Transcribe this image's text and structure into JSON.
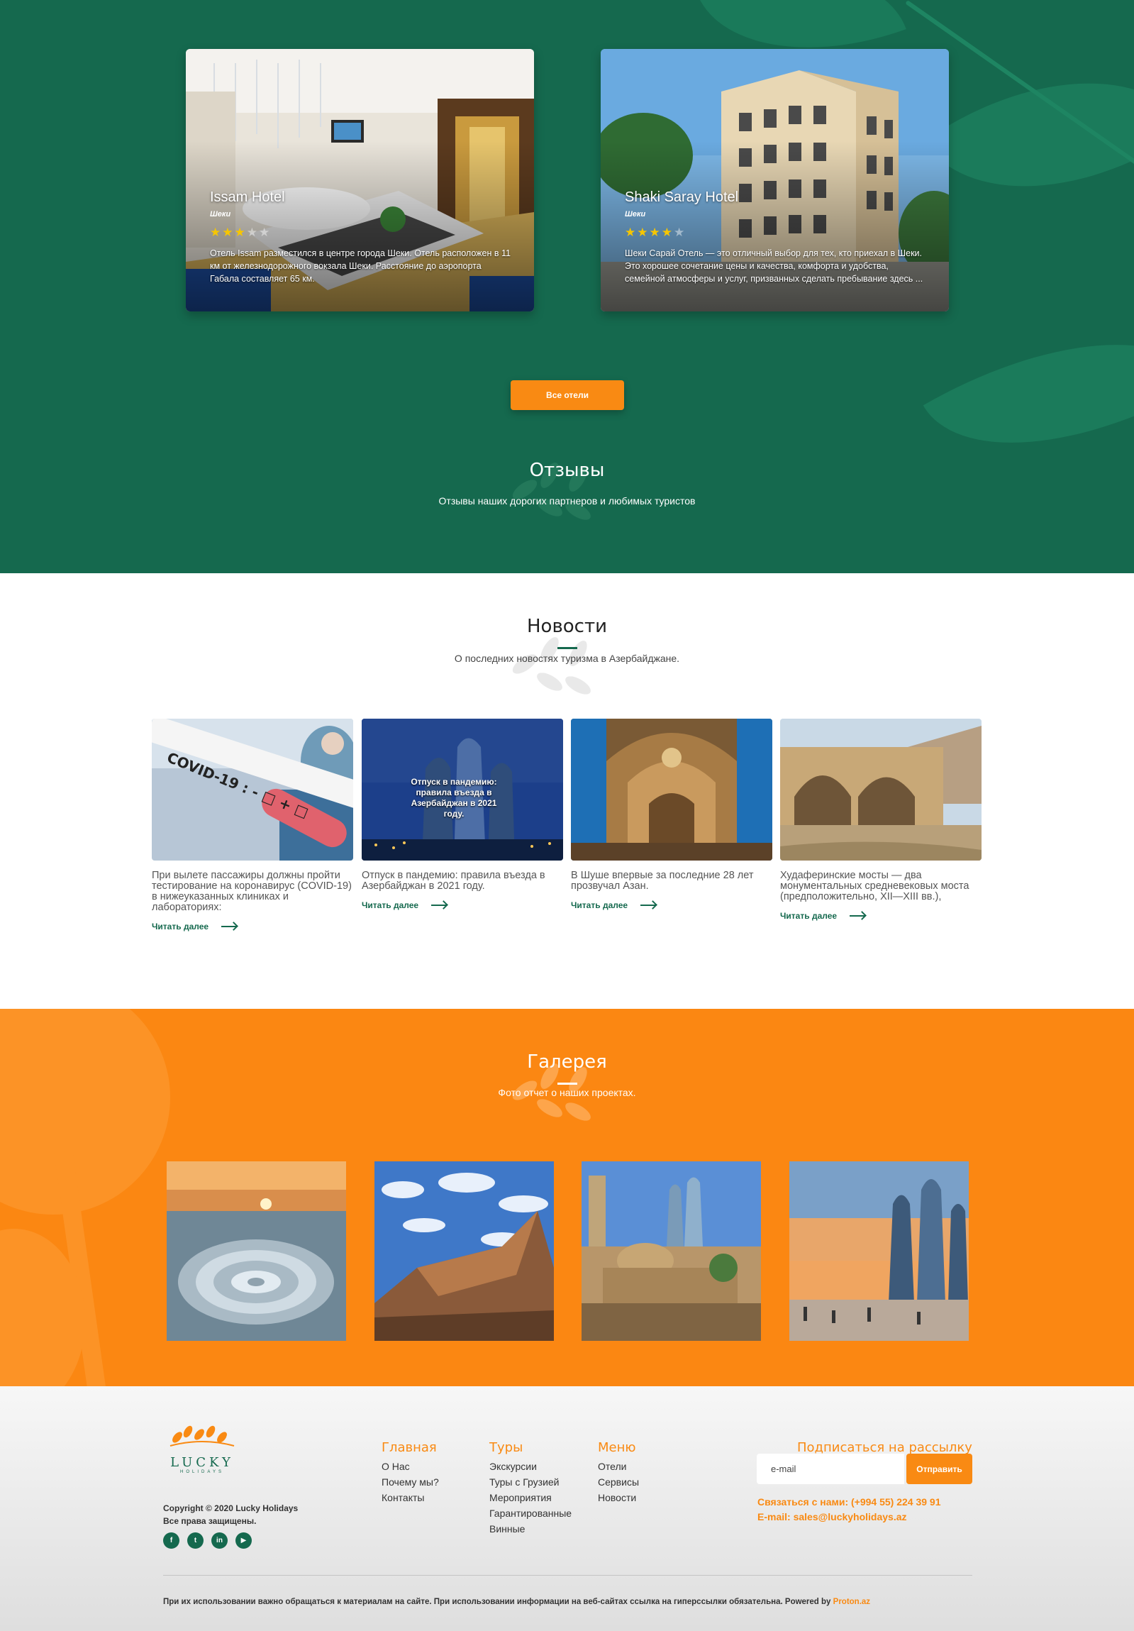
{
  "hotels": {
    "cards": [
      {
        "name": "Issam Hotel",
        "city": "Шеки",
        "stars": 3,
        "description": "Отель Issam разместился в центре города Шеки. Отель расположен в 11 км от железнодорожного вокзала Шеки. Расстояние до аэропорта Габала составляет 65 км."
      },
      {
        "name": "Shaki Saray Hotel",
        "city": "Шеки",
        "stars": 4,
        "description": "Шеки Сарай Отель — это отличный выбор для тех, кто приехал в Шеки. Это хорошее сочетание цены и качества, комфорта и удобства, семейной атмосферы и услуг, призванных сделать пребывание здесь ..."
      }
    ],
    "all_button": "Все отели"
  },
  "reviews": {
    "title": "Отзывы",
    "subtitle": "Отзывы наших дорогих партнеров и любимых туристов"
  },
  "news": {
    "title": "Новости",
    "subtitle": "О последних новостях туризма в Азербайджане.",
    "read_more": "Читать далее",
    "items": [
      {
        "title": "При вылете пассажиры должны пройти тестирование на коронавирус (COVID-19) в нижеуказанных клиниках и лабораториях:",
        "image": "covid-test-tube",
        "image_caption": ""
      },
      {
        "title": "Отпуск в пандемию: правила въезда в Азербайджан в 2021 году.",
        "image": "flame-towers-night",
        "image_caption": "Отпуск в пандемию: правила въезда в Азербайджан в 2021 году."
      },
      {
        "title": "В Шуше впервые за последние 28 лет прозвучал Азан.",
        "image": "mosque-interior",
        "image_caption": ""
      },
      {
        "title": "Худаферинские мосты — два монументальных средневековых моста (предположительно, XII—XIII вв.),",
        "image": "khudafarin-bridge",
        "image_caption": ""
      }
    ]
  },
  "gallery": {
    "title": "Галерея",
    "subtitle": "Фото отчет о наших проектах.",
    "images": [
      "mud-volcano-sunset",
      "gobustan-rock",
      "old-city-baku",
      "flame-towers-sunset"
    ]
  },
  "footer": {
    "logo_word": "LUCKY",
    "logo_sub": "HOLIDAYS",
    "copyright_line1": "Copyright © 2020 Lucky Holidays",
    "copyright_line2": "Все права защищены.",
    "socials": [
      "facebook-icon",
      "twitter-icon",
      "linkedin-icon",
      "youtube-icon"
    ],
    "columns": [
      {
        "heading": "Главная",
        "links": [
          "О Нас",
          "Почему мы?",
          "Контакты"
        ]
      },
      {
        "heading": "Туры",
        "links": [
          "Экскурсии",
          "Туры с Грузией",
          "Мероприятия",
          "Гарантированные",
          "Винные"
        ]
      },
      {
        "heading": "Меню",
        "links": [
          "Отели",
          "Сервисы",
          "Новости"
        ]
      }
    ],
    "newsletter": {
      "heading": "Подписаться на рассылку",
      "placeholder": "e-mail",
      "button": "Отправить"
    },
    "contact_phone": "Связаться с нами: (+994 55) 224 39 91",
    "contact_email": "E-mail: sales@luckyholidays.az",
    "legal": "При их использовании важно обращаться к материалам на сайте. При использовании информации на веб-сайтах ссылка на гиперссылки обязательна. Powered by",
    "powered_by": "Proton.az"
  },
  "colors": {
    "green": "#15694e",
    "orange": "#f98a13",
    "gallery_orange": "#fb8712"
  }
}
